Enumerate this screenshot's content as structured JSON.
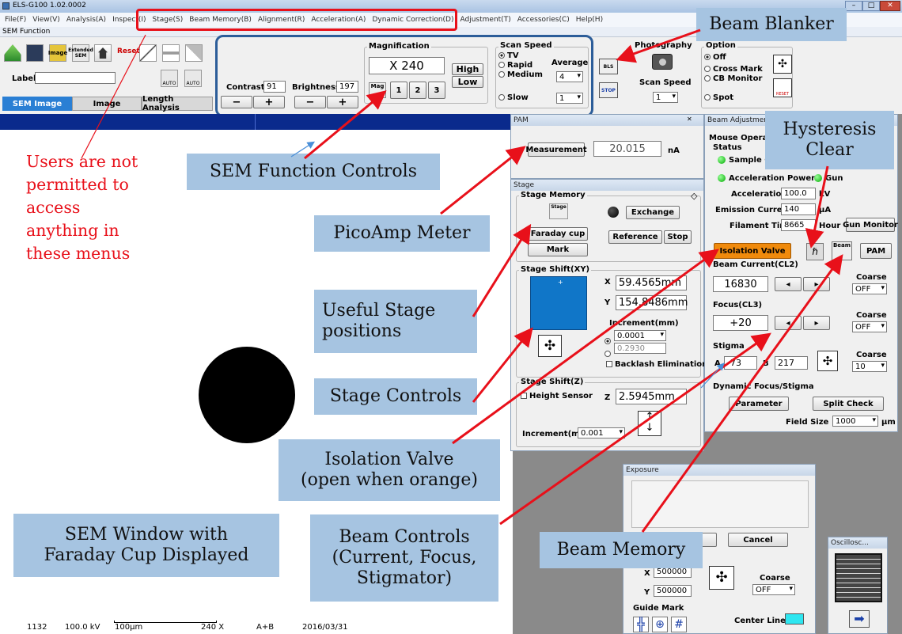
{
  "window": {
    "title": "ELS-G100 1.02.0002",
    "subtitle": "SEM Function"
  },
  "menu": [
    "File(F)",
    "View(V)",
    "Analysis(A)",
    "Inspect(I)",
    "Stage(S)",
    "Beam Memory(B)",
    "Alignment(R)",
    "Acceleration(A)",
    "Dynamic Correction(D)",
    "Adjustment(T)",
    "Accessories(C)",
    "Help(H)"
  ],
  "toolbar": {
    "extended_sem": "Extended SEM",
    "image_btn": "Image",
    "reset": "Reset",
    "label": "Label",
    "auto1": "AUTO",
    "auto2": "AUTO"
  },
  "tabs": [
    "SEM Image",
    "Image",
    "Length Analysis"
  ],
  "controls": {
    "contrast_label": "Contrast",
    "contrast_value": "91",
    "brightness_label": "Brightness",
    "brightness_value": "197",
    "minus": "−",
    "plus": "+"
  },
  "magnification": {
    "title": "Magnification",
    "value": "X 240",
    "high": "High",
    "low": "Low",
    "mag": "Mag",
    "b1": "1",
    "b2": "2",
    "b3": "3"
  },
  "scan_speed": {
    "title": "Scan Speed",
    "tv": "TV",
    "rapid": "Rapid",
    "medium": "Medium",
    "slow": "Slow",
    "average": "Average",
    "avg_value": "4",
    "slow_value": "1"
  },
  "photography": {
    "title": "Photography",
    "bls": "BLS",
    "stop": "STOP",
    "scan_speed": "Scan Speed",
    "scan_value": "1"
  },
  "option": {
    "title": "Option",
    "off": "Off",
    "cross": "Cross Mark",
    "cb": "CB Monitor",
    "spot": "Spot",
    "reset": "RESET"
  },
  "pam": {
    "title": "PAM",
    "measurement": "Measurement",
    "value": "20.015",
    "unit": "nA"
  },
  "stage": {
    "title": "Stage",
    "memory": "Stage Memory",
    "stage_btn": "Stage",
    "exchange": "Exchange",
    "faraday": "Faraday cup",
    "mark": "Mark",
    "reference": "Reference",
    "stop": "Stop",
    "shift_xy": "Stage Shift(XY)",
    "x": "X",
    "y": "Y",
    "x_value": "59.4565mm",
    "y_value": "154.8486mm",
    "increment": "Increment(mm)",
    "inc1": "0.0001",
    "inc2": "0.2930",
    "backlash": "Backlash Elimination",
    "shift_z": "Stage Shift(Z)",
    "height": "Height Sensor",
    "z": "Z",
    "z_value": "2.5945mm",
    "inc_z_label": "Increment(mm)",
    "inc_z": "0.001",
    "diamond": "◇"
  },
  "beam": {
    "title": "Beam Adjustment",
    "mouse": "Mouse Operation",
    "status": "Status",
    "sample": "Sample C",
    "acc_power": "Acceleration Power",
    "gun": "Gun",
    "acceleration": "Acceleration",
    "acc_value": "100.0",
    "acc_unit": "kV",
    "emission": "Emission Current",
    "em_value": "140",
    "em_unit": "µA",
    "filament": "Filament Time",
    "fil_value": "8665",
    "fil_unit": "Hour",
    "gun_monitor": "Gun Monitor",
    "isolation": "Isolation Valve",
    "beam_btn": "Beam",
    "pam_btn": "PAM",
    "current": "Beam Current(CL2)",
    "current_value": "16830",
    "coarse": "Coarse",
    "off": "OFF",
    "focus": "Focus(CL3)",
    "focus_value": "+20",
    "stigma": "Stigma",
    "a": "A",
    "a_value": "-73",
    "b": "B",
    "b_value": "217",
    "stig_coarse": "10",
    "dyn": "Dynamic Focus/Stigma",
    "parameter": "Parameter",
    "split": "Split Check",
    "field": "Field Size",
    "field_value": "1000",
    "field_unit": "µm"
  },
  "exposure": {
    "title": "Exposure",
    "cancel": "Cancel",
    "x": "X",
    "y": "Y",
    "x_value": "500000",
    "y_value": "500000",
    "coarse": "Coarse",
    "off": "OFF",
    "guide": "Guide Mark",
    "center": "Center Line"
  },
  "osc": {
    "title": "Oscillosc..."
  },
  "status_bar": {
    "a": "1132",
    "b": "100.0 kV",
    "c": "100µm",
    "d": "240 X",
    "e": "A+B",
    "f": "2016/03/31"
  },
  "annotations": {
    "beam_blanker": "Beam Blanker",
    "hysteresis": "Hysteresis\nClear",
    "users": "Users are not\npermitted to\naccess\nanything in\nthese menus",
    "sem_function": "SEM Function  Controls",
    "picoamp": "PicoAmp Meter",
    "useful": "Useful Stage\npositions",
    "stage_controls": "Stage Controls",
    "isolation": "Isolation Valve\n(open when orange)",
    "sem_window": "SEM Window with\nFaraday Cup Displayed",
    "beam_controls": "Beam Controls\n(Current, Focus,\nStigmator)",
    "beam_memory": "Beam Memory"
  },
  "colors": {
    "annotation_bg": "#a6c4e1",
    "arrow": "#e8101a",
    "isolation_orange": "#f08a0c",
    "tab_active": "#2a7fd4",
    "stage_shift_blue": "#1076c8"
  }
}
